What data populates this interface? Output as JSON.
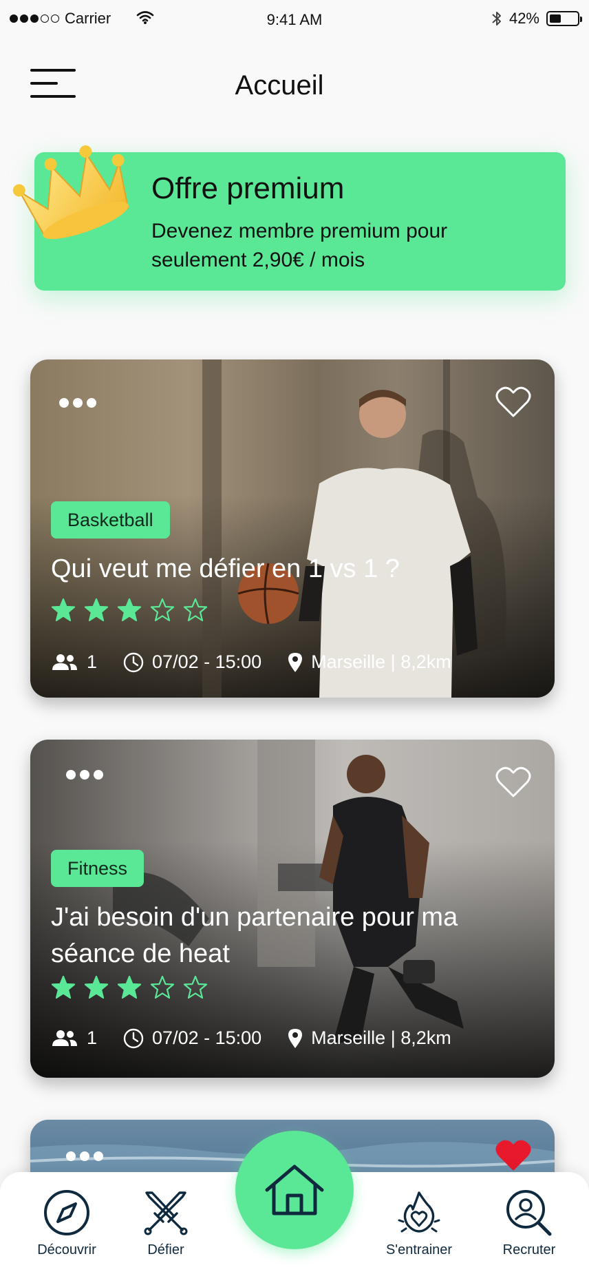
{
  "status_bar": {
    "carrier": "Carrier",
    "time": "9:41 AM",
    "battery": "42%",
    "battery_level": 0.42
  },
  "header": {
    "title": "Accueil"
  },
  "premium": {
    "title": "Offre premium",
    "subtitle": "Devenez membre premium pour seulement 2,90€ / mois"
  },
  "cards": [
    {
      "tag": "Basketball",
      "title": "Qui veut me défier en 1 vs 1 ?",
      "rating": 3,
      "rating_max": 5,
      "participants": "1",
      "datetime": "07/02 - 15:00",
      "location": "Marseille | 8,2km",
      "favorited": false
    },
    {
      "tag": "Fitness",
      "title": "J'ai besoin d'un partenaire pour ma séance de heat",
      "rating": 3,
      "rating_max": 5,
      "participants": "1",
      "datetime": "07/02 - 15:00",
      "location": "Marseille | 8,2km",
      "favorited": false
    },
    {
      "favorited": true
    }
  ],
  "bottom_nav": {
    "discover": "Découvrir",
    "challenge": "Défier",
    "train": "S'entrainer",
    "recruit": "Recruter"
  },
  "colors": {
    "accent": "#5be896",
    "navy": "#0f2a3e",
    "favorite": "#e8192c"
  },
  "icons": [
    "menu-icon",
    "crown-icon",
    "more-icon",
    "heart-icon",
    "star-icon",
    "group-icon",
    "clock-icon",
    "location-pin-icon",
    "compass-icon",
    "swords-icon",
    "home-icon",
    "flame-heart-icon",
    "search-person-icon"
  ]
}
